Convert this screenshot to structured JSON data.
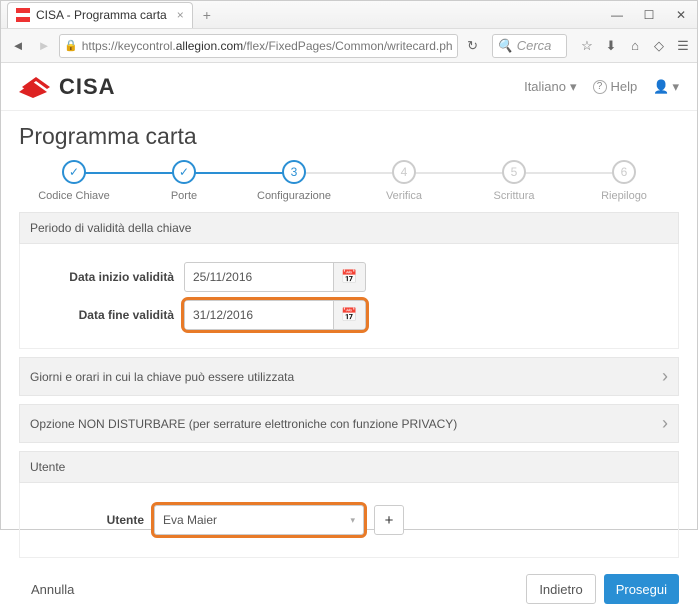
{
  "browser": {
    "tab_title": "CISA - Programma carta",
    "url_prefix": "https://keycontrol.",
    "url_host": "allegion.com",
    "url_path": "/flex/FixedPages/Common/writecard.ph",
    "search_placeholder": "Cerca"
  },
  "header": {
    "brand": "CISA",
    "language": "Italiano",
    "help": "Help"
  },
  "page": {
    "title": "Programma carta"
  },
  "steps": [
    {
      "label": "Codice Chiave",
      "mark": "✓",
      "state": "done"
    },
    {
      "label": "Porte",
      "mark": "✓",
      "state": "done"
    },
    {
      "label": "Configurazione",
      "mark": "3",
      "state": "active"
    },
    {
      "label": "Verifica",
      "mark": "4",
      "state": "future"
    },
    {
      "label": "Scrittura",
      "mark": "5",
      "state": "future"
    },
    {
      "label": "Riepilogo",
      "mark": "6",
      "state": "future"
    }
  ],
  "validity": {
    "panel_title": "Periodo di validità della chiave",
    "start_label": "Data inizio validità",
    "start_value": "25/11/2016",
    "end_label": "Data fine validità",
    "end_value": "31/12/2016"
  },
  "schedule_panel": "Giorni e orari in cui la chiave può essere utilizzata",
  "dnd_panel": "Opzione NON DISTURBARE (per serrature elettroniche con funzione PRIVACY)",
  "user_panel": {
    "title": "Utente",
    "field_label": "Utente",
    "value": "Eva Maier"
  },
  "buttons": {
    "cancel": "Annulla",
    "back": "Indietro",
    "next": "Prosegui"
  }
}
